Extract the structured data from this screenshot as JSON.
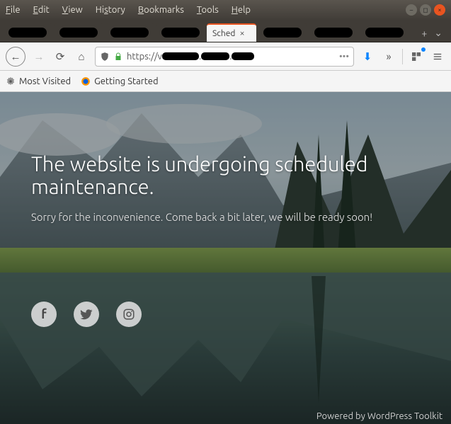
{
  "menu": {
    "file": "File",
    "edit": "Edit",
    "view": "View",
    "history": "History",
    "bookmarks": "Bookmarks",
    "tools": "Tools",
    "help": "Help"
  },
  "tabs": {
    "active_label": "Sched"
  },
  "url": {
    "prefix": "https://v",
    "dots": "•••"
  },
  "bookmarks": {
    "most_visited": "Most Visited",
    "getting_started": "Getting Started"
  },
  "page": {
    "heading": "The website is undergoing scheduled maintenance.",
    "subtext": "Sorry for the inconvenience. Come back a bit later, we will be ready soon!",
    "footer": "Powered by WordPress Toolkit"
  },
  "icons": {
    "newtab": "+",
    "tabdropdown": "⌄",
    "back": "←",
    "forward": "→",
    "reload": "⟳",
    "home": "⌂",
    "shield": "🛡",
    "lock": "🔒",
    "download": "⬇",
    "overflow": "»",
    "facebook": "f",
    "twitter": "t",
    "instagram": "▢"
  }
}
